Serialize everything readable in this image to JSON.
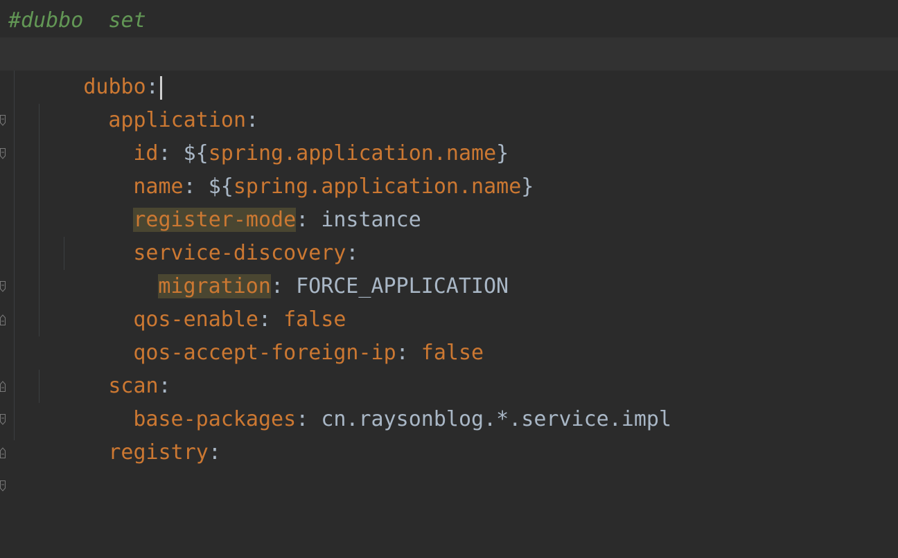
{
  "colors": {
    "background": "#2b2b2b",
    "current_line": "#323232",
    "key": "#cc7832",
    "text": "#a9b7c6",
    "comment": "#629755",
    "highlight": "#4a4631"
  },
  "lines": [
    {
      "comment": "#dubbo  set"
    },
    {
      "key": "dubbo",
      "sep": ":"
    },
    {
      "key": "application",
      "sep": ":"
    },
    {
      "key": "id",
      "sep": ": ",
      "tpl_open": "${",
      "tpl_body": "spring.application.name",
      "tpl_close": "}"
    },
    {
      "key": "name",
      "sep": ": ",
      "tpl_open": "${",
      "tpl_body": "spring.application.name",
      "tpl_close": "}"
    },
    {
      "key": "register-mode",
      "sep": ": ",
      "value": "instance"
    },
    {
      "key": "service-discovery",
      "sep": ":"
    },
    {
      "key": "migration",
      "sep": ": ",
      "value": "FORCE_APPLICATION"
    },
    {
      "key": "qos-enable",
      "sep": ": ",
      "value": "false"
    },
    {
      "key": "qos-accept-foreign-ip",
      "sep": ": ",
      "value": "false"
    },
    {
      "key": "scan",
      "sep": ":"
    },
    {
      "key": "base-packages",
      "sep": ": ",
      "value": "cn.raysonblog.*.service.impl"
    },
    {
      "key": "registry",
      "sep": ":"
    }
  ],
  "icons": {
    "fold_open": "fold-open-icon",
    "fold_close": "fold-close-icon"
  }
}
